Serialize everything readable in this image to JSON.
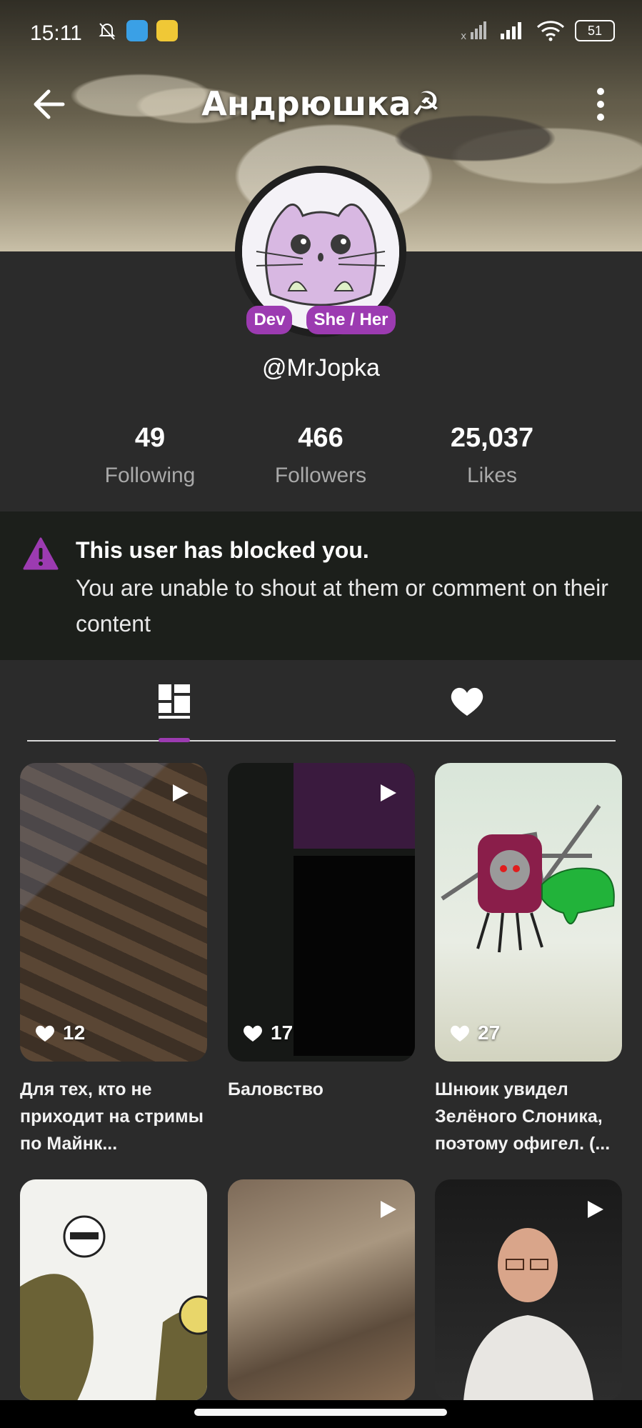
{
  "status_bar": {
    "time": "15:11",
    "battery": "51"
  },
  "header": {
    "title": "Андрюшка☭",
    "back_icon": "arrow-left-icon",
    "more_icon": "more-vertical-icon"
  },
  "profile": {
    "badges": [
      "Dev",
      "She / Her"
    ],
    "username": "@MrJopka"
  },
  "stats": [
    {
      "value": "49",
      "label": "Following"
    },
    {
      "value": "466",
      "label": "Followers"
    },
    {
      "value": "25,037",
      "label": "Likes"
    }
  ],
  "notice": {
    "title": "This user has blocked you.",
    "body": "You are unable to shout at them or comment on their content",
    "accent": "#9c3bb1"
  },
  "tabs": {
    "posts_icon": "grid-icon",
    "likes_icon": "heart-icon"
  },
  "posts": [
    {
      "likes": "12",
      "caption": "Для тех, кто не приходит на стримы по Майнк..."
    },
    {
      "likes": "17",
      "caption": "Баловство"
    },
    {
      "likes": "27",
      "caption": "Шнюик увидел Зелёного Слоника, поэтому офигел. (..."
    },
    {
      "likes": "",
      "caption": ""
    },
    {
      "likes": "",
      "caption": ""
    },
    {
      "likes": "",
      "caption": ""
    }
  ]
}
